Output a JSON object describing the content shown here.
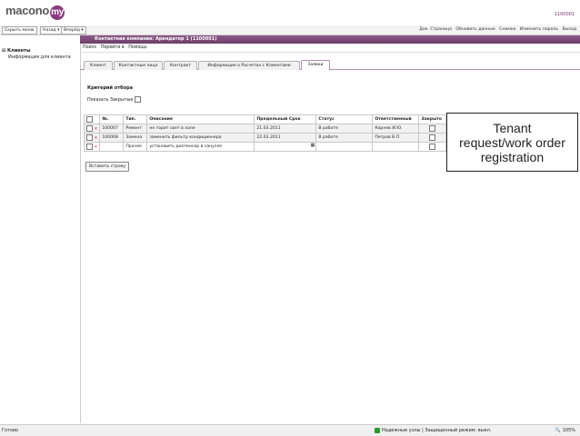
{
  "header": {
    "logo_text": "macono",
    "logo_badge": "my",
    "user_id": "1100001"
  },
  "toolbar": {
    "hide_menu": "Скрыть меню",
    "back": "Назад ▾",
    "forward": "Вперёд ▾",
    "links": [
      "Док. Страница",
      "Обновить данные",
      "Снимок",
      "Изменить пароль",
      "Выход"
    ]
  },
  "sidebar": {
    "root": "Клиенты",
    "child": "Информация для клиента"
  },
  "title_bar": {
    "title": "Контактная компания: Арендатор 1 (1100001)"
  },
  "menu": [
    "Поиск",
    "Перейти в",
    "Помощь"
  ],
  "tabs": [
    {
      "label": "Клиент",
      "active": false
    },
    {
      "label": "Контактные лица",
      "active": false
    },
    {
      "label": "Контракт",
      "active": false
    },
    {
      "label": "Информация о Расчетах с Клиентами",
      "active": false
    },
    {
      "label": "Заявки",
      "active": true
    }
  ],
  "filter": {
    "heading": "Критерий отбора",
    "show_closed": "Показать Закрытые"
  },
  "table": {
    "columns": [
      "",
      "№.",
      "Тип.",
      "Описание",
      "Предельный Срок",
      "Статус",
      "Ответственный",
      "Закрыто"
    ],
    "rows": [
      {
        "num": "100007",
        "type": "Ремонт",
        "description": "не горит свет в холе",
        "deadline": "21.03.2011",
        "status": "В работе",
        "responsible": "Корнев И.Ю.",
        "closed": false
      },
      {
        "num": "100008",
        "type": "Замена",
        "description": "заменить фильтр кондиционера",
        "deadline": "22.03.2011",
        "status": "В работе",
        "responsible": "Петров В.П.",
        "closed": false
      },
      {
        "num": "",
        "type": "Прочее",
        "description": "установить диспенсер в санузле",
        "deadline": "",
        "status": "",
        "responsible": "",
        "closed": false
      }
    ]
  },
  "insert_row": "Вставить строку",
  "callout": [
    "Tenant",
    "request/work order",
    "registration"
  ],
  "status_bar": {
    "ready": "Готово",
    "trusted": "Надежные узлы | Защищенный режим: выкл.",
    "zoom": "105%"
  }
}
